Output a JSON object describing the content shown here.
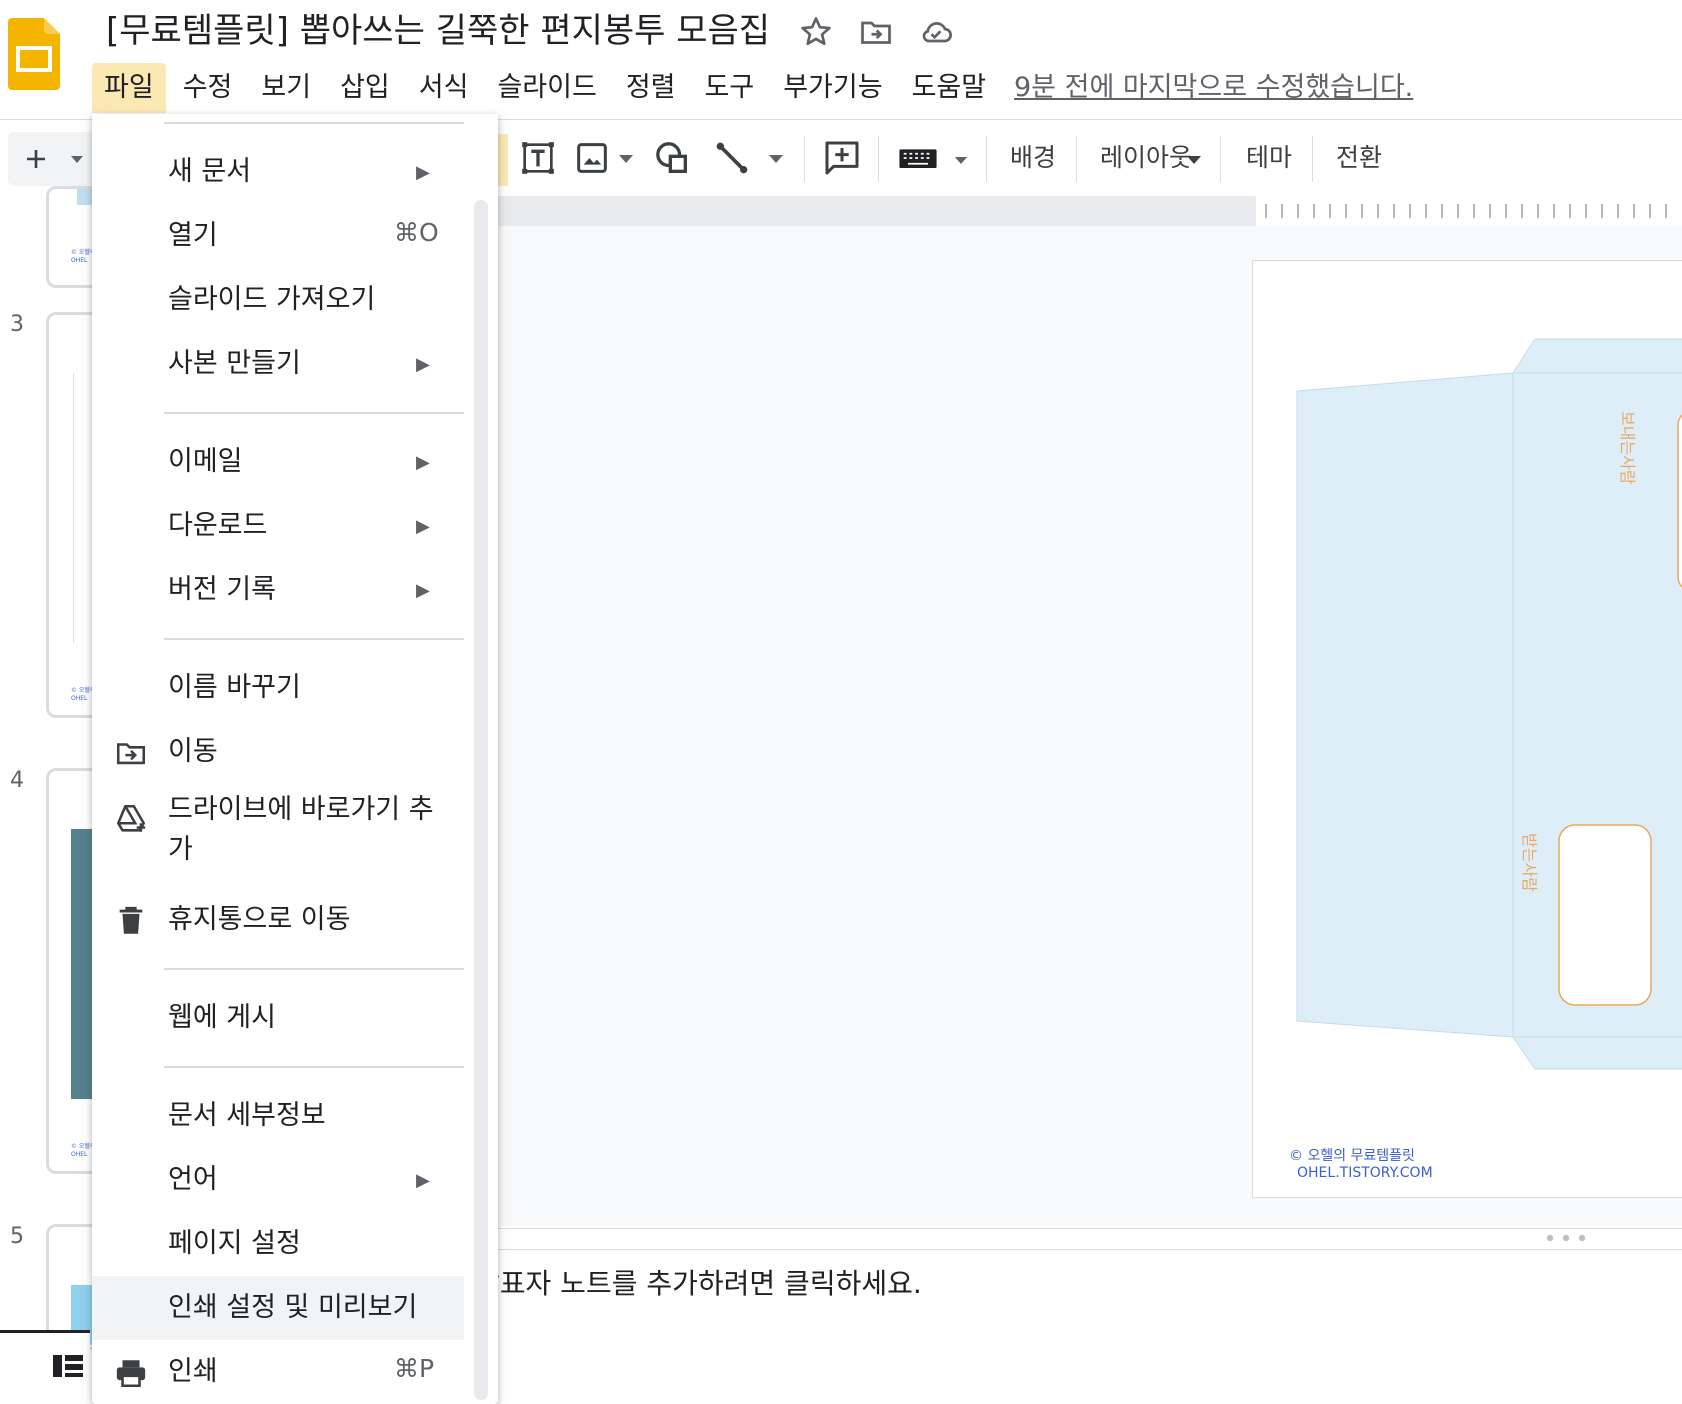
{
  "header": {
    "title": "[무료템플릿] 뽑아쓰는 길쭉한 편지봉투 모음집",
    "last_edit": "9분 전에 마지막으로 수정했습니다.",
    "menu": [
      "파일",
      "수정",
      "보기",
      "삽입",
      "서식",
      "슬라이드",
      "정렬",
      "도구",
      "부가기능",
      "도움말"
    ],
    "active_menu": "파일"
  },
  "toolbar": {
    "background_label": "배경",
    "layout_label": "레이아웃",
    "theme_label": "테마",
    "transition_label": "전환"
  },
  "filmstrip": {
    "slide_numbers": [
      "3",
      "4",
      "5"
    ],
    "thumb_mark_line1": "© 오헬의",
    "thumb_mark_line2": "OHEL"
  },
  "file_menu": {
    "items": [
      {
        "label": "새 문서",
        "submenu": true
      },
      {
        "label": "열기",
        "shortcut": "⌘O"
      },
      {
        "label": "슬라이드 가져오기"
      },
      {
        "label": "사본 만들기",
        "submenu": true
      },
      {
        "label": "이메일",
        "submenu": true
      },
      {
        "label": "다운로드",
        "submenu": true
      },
      {
        "label": "버전 기록",
        "submenu": true
      },
      {
        "label": "이름 바꾸기"
      },
      {
        "label": "이동",
        "icon": "move-folder-icon"
      },
      {
        "label": "드라이브에 바로가기 추가",
        "icon": "drive-shortcut-icon"
      },
      {
        "label": "휴지통으로 이동",
        "icon": "trash-icon"
      },
      {
        "label": "웹에 게시"
      },
      {
        "label": "문서 세부정보"
      },
      {
        "label": "언어",
        "submenu": true
      },
      {
        "label": "페이지 설정"
      },
      {
        "label": "인쇄 설정 및 미리보기",
        "highlighted": true
      },
      {
        "label": "인쇄",
        "shortcut": "⌘P",
        "icon": "print-icon"
      }
    ]
  },
  "slide": {
    "sender_label": "보내는사람",
    "receiver_label": "받는사람",
    "credit_line1": "© 오헬의 무료템플릿",
    "credit_line2": "OHEL.TISTORY.COM"
  },
  "notes": {
    "placeholder": "발표자 노트를 추가하려면 클릭하세요."
  },
  "colors": {
    "accent_yellow": "#f4b400",
    "menu_active": "#fce8b2",
    "envelope_blue": "#deeef8",
    "envelope_orange": "#e8a860",
    "credit_blue": "#3c5fcf"
  }
}
